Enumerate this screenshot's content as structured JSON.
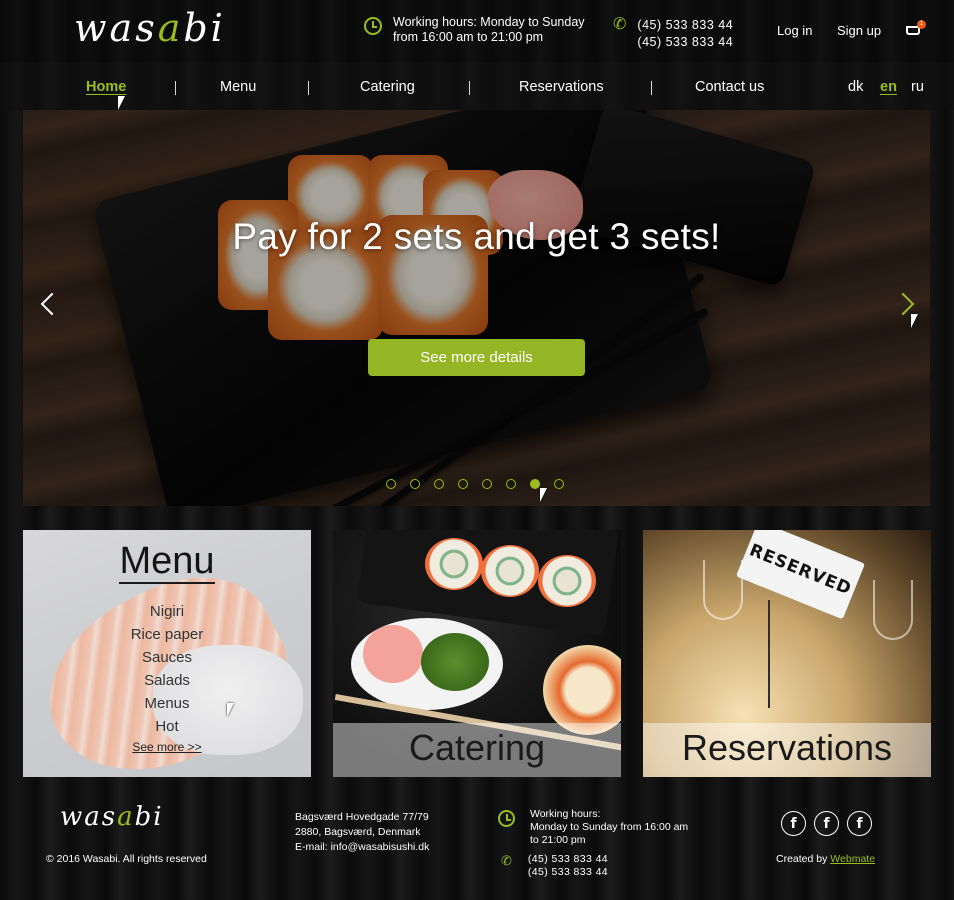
{
  "header": {
    "logo_text": "wasabi",
    "working_hours_line1": "Working hours: Monday to Sunday",
    "working_hours_line2": "from 16:00 am to 21:00 pm",
    "phone1": "(45)  533  833  44",
    "phone2": "(45)  533  833  44",
    "login_label": "Log in",
    "signup_label": "Sign up",
    "cart_count": "1"
  },
  "nav": {
    "items": [
      {
        "label": "Home",
        "active": true
      },
      {
        "label": "Menu",
        "active": false
      },
      {
        "label": "Catering",
        "active": false
      },
      {
        "label": "Reservations",
        "active": false
      },
      {
        "label": "Contact us",
        "active": false
      }
    ],
    "languages": [
      {
        "label": "dk",
        "active": false
      },
      {
        "label": "en",
        "active": true
      },
      {
        "label": "ru",
        "active": false
      }
    ]
  },
  "hero": {
    "title": "Pay for 2 sets and get 3 sets!",
    "cta_label": "See more details",
    "slide_count": 8,
    "active_slide": 7
  },
  "cards": {
    "menu": {
      "title": "Menu",
      "items": [
        "Nigiri",
        "Rice paper",
        "Sauces",
        "Salads",
        "Menus",
        "Hot"
      ],
      "more_label": "See more >>"
    },
    "catering": {
      "label": "Catering"
    },
    "reservations": {
      "label": "Reservations",
      "sign_text": "RESERVED"
    }
  },
  "footer": {
    "logo_text": "wasabi",
    "copyright": "© 2016 Wasabi. All rights reserved",
    "address_line1": "Bagsværd Hovedgade 77/79",
    "address_line2": "2880, Bagsværd, Denmark",
    "address_line3": "E-mail: info@wasabisushi.dk",
    "hours_line1": "Working hours:",
    "hours_line2": "Monday to Sunday from 16:00 am",
    "hours_line3": "to 21:00 pm",
    "phone1": "(45)  533  833  44",
    "phone2": "(45)  533  833  44",
    "social_glyph": "f",
    "created_by": "Created by",
    "created_link": "Webmate"
  },
  "colors": {
    "accent": "#9bbd1e",
    "cta": "#94b524",
    "badge": "#e85a14"
  },
  "icons": [
    "clock-icon",
    "phone-icon",
    "cart-icon",
    "chevron-left-icon",
    "chevron-right-icon",
    "facebook-icon"
  ]
}
